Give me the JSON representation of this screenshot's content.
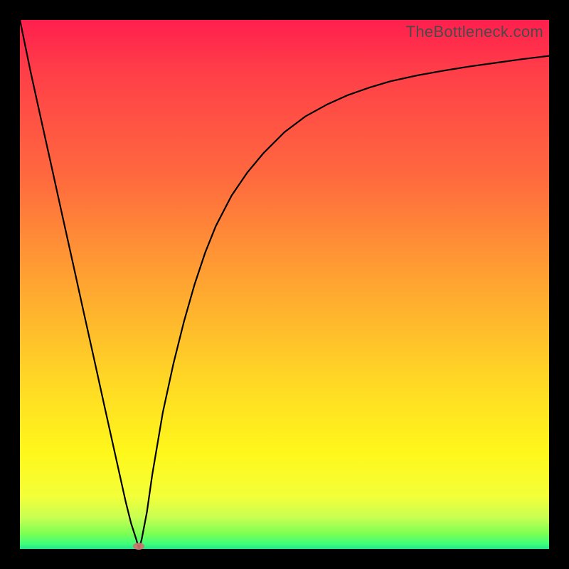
{
  "watermark": "TheBottleneck.com",
  "chart_data": {
    "type": "line",
    "title": "",
    "xlabel": "",
    "ylabel": "",
    "xlim": [
      0,
      1
    ],
    "ylim": [
      0,
      1
    ],
    "marker": {
      "x": 0.225,
      "y": 0.005
    },
    "series": [
      {
        "name": "curve",
        "x": [
          0.0,
          0.02,
          0.04,
          0.06,
          0.08,
          0.1,
          0.12,
          0.14,
          0.16,
          0.18,
          0.2,
          0.21,
          0.22,
          0.225,
          0.23,
          0.24,
          0.25,
          0.27,
          0.29,
          0.31,
          0.33,
          0.35,
          0.37,
          0.4,
          0.43,
          0.46,
          0.5,
          0.54,
          0.58,
          0.62,
          0.66,
          0.7,
          0.75,
          0.8,
          0.85,
          0.9,
          0.95,
          1.0
        ],
        "y": [
          1.0,
          0.903,
          0.812,
          0.722,
          0.631,
          0.541,
          0.45,
          0.36,
          0.269,
          0.179,
          0.089,
          0.049,
          0.018,
          0.0,
          0.018,
          0.07,
          0.14,
          0.258,
          0.35,
          0.43,
          0.5,
          0.56,
          0.61,
          0.668,
          0.712,
          0.748,
          0.788,
          0.818,
          0.84,
          0.858,
          0.872,
          0.884,
          0.895,
          0.904,
          0.912,
          0.919,
          0.926,
          0.932
        ]
      }
    ],
    "background_gradient": {
      "top": "#ff1f4e",
      "upper_mid": "#ffa531",
      "mid": "#fff81b",
      "lower_mid": "#c8ff52",
      "bottom": "#25e28a"
    }
  }
}
